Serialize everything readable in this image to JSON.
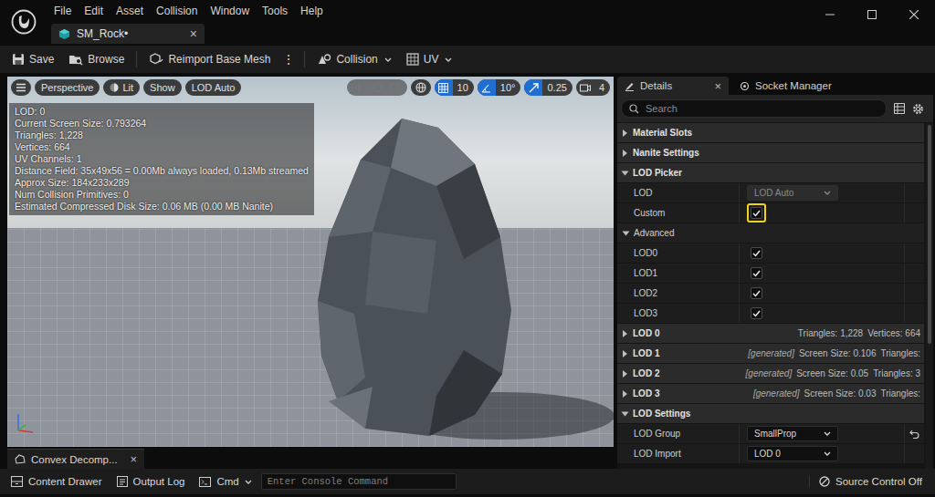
{
  "menu": [
    "File",
    "Edit",
    "Asset",
    "Collision",
    "Window",
    "Tools",
    "Help"
  ],
  "document_tab": {
    "label": "SM_Rock•",
    "close": "×",
    "selected": true
  },
  "toolbar": {
    "save": "Save",
    "browse": "Browse",
    "reimport": "Reimport Base Mesh",
    "more": "⋮",
    "collision": "Collision",
    "uv": "UV"
  },
  "viewport": {
    "view_mode": "Perspective",
    "lighting": "Lit",
    "show": "Show",
    "lod": "LOD Auto",
    "transform_tools": {
      "disabled": true
    },
    "grid_snap": {
      "value": "10",
      "on": true
    },
    "rotation_snap": {
      "value": "10°",
      "on": true
    },
    "scale_snap": {
      "value": "0.25",
      "on": true
    },
    "camera_speed": "4",
    "stats": [
      "LOD: 0",
      "Current Screen Size: 0.793264",
      "Triangles: 1,228",
      "Vertices: 664",
      "UV Channels: 1",
      "Distance Field: 35x49x56 = 0.00Mb always loaded, 0.13Mb streamed",
      "Approx Size: 184x233x289",
      "Num Collision Primitives: 0",
      "Estimated Compressed Disk Size: 0.06 MB (0.00 MB Nanite)"
    ]
  },
  "details": {
    "tabs": [
      {
        "label": "Details",
        "selected": true,
        "close": "×"
      },
      {
        "label": "Socket Manager",
        "selected": false
      }
    ],
    "search_placeholder": "Search",
    "rows": [
      {
        "kind": "category",
        "label": "Material Slots",
        "expanded": false
      },
      {
        "kind": "category",
        "label": "Nanite Settings",
        "expanded": false
      },
      {
        "kind": "category",
        "label": "LOD Picker",
        "expanded": true
      },
      {
        "kind": "dropdown",
        "label": "LOD",
        "value": "LOD Auto",
        "disabled": true,
        "resettable": false
      },
      {
        "kind": "checkbox",
        "label": "Custom",
        "checked": true,
        "focused": true
      },
      {
        "kind": "group",
        "label": "Advanced",
        "expanded": true
      },
      {
        "kind": "checkbox",
        "label": "LOD0",
        "checked": true,
        "focused": false
      },
      {
        "kind": "checkbox",
        "label": "LOD1",
        "checked": true,
        "focused": false
      },
      {
        "kind": "checkbox",
        "label": "LOD2",
        "checked": true,
        "focused": false
      },
      {
        "kind": "checkbox",
        "label": "LOD3",
        "checked": true,
        "focused": false
      },
      {
        "kind": "lod",
        "label": "LOD 0",
        "expanded": false,
        "tag": "",
        "summary": [
          "Triangles: 1,228",
          "Vertices: 664"
        ]
      },
      {
        "kind": "lod",
        "label": "LOD 1",
        "expanded": false,
        "tag": "[generated]",
        "summary": [
          "Screen Size: 0.106",
          "Triangles:"
        ]
      },
      {
        "kind": "lod",
        "label": "LOD 2",
        "expanded": false,
        "tag": "[generated]",
        "summary": [
          "Screen Size: 0.05",
          "Triangles: 3"
        ]
      },
      {
        "kind": "lod",
        "label": "LOD 3",
        "expanded": false,
        "tag": "[generated]",
        "summary": [
          "Screen Size: 0.03",
          "Triangles:"
        ]
      },
      {
        "kind": "category",
        "label": "LOD Settings",
        "expanded": true
      },
      {
        "kind": "dropdown",
        "label": "LOD Group",
        "value": "SmallProp",
        "disabled": false,
        "resettable": true
      },
      {
        "kind": "dropdown",
        "label": "LOD Import",
        "value": "LOD 0",
        "disabled": false,
        "resettable": false
      }
    ]
  },
  "bottom_tabs": [
    {
      "label": "Convex Decomp...",
      "close": "×",
      "selected": true
    }
  ],
  "status_bar": {
    "content_drawer": "Content Drawer",
    "output_log": "Output Log",
    "cmd": "Cmd",
    "console_placeholder": "Enter Console Command",
    "source_control": "Source Control Off"
  }
}
